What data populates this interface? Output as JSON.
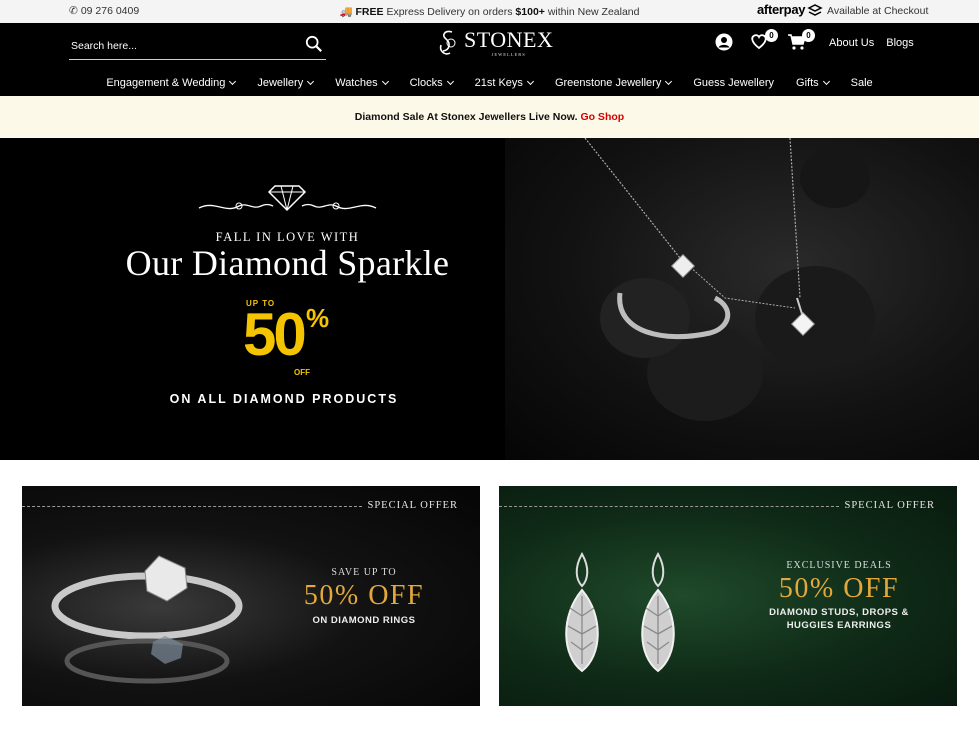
{
  "topbar": {
    "phone": "09 276 0409",
    "promo_bold": "FREE",
    "promo_text": "Express Delivery on orders",
    "promo_amount": "$100+",
    "promo_tail": "within New Zealand",
    "afterpay_logo": "afterpay",
    "afterpay_text": "Available at Checkout"
  },
  "header": {
    "search_placeholder": "Search here...",
    "logo_word": "STONEX",
    "logo_sub": "JEWELLERS",
    "wishlist_count": "0",
    "cart_count": "0",
    "links": [
      "About Us",
      "Blogs"
    ]
  },
  "nav": [
    {
      "label": "Engagement & Wedding",
      "dropdown": true
    },
    {
      "label": "Jewellery",
      "dropdown": true
    },
    {
      "label": "Watches",
      "dropdown": true
    },
    {
      "label": "Clocks",
      "dropdown": true
    },
    {
      "label": "21st Keys",
      "dropdown": true
    },
    {
      "label": "Greenstone Jewellery",
      "dropdown": true
    },
    {
      "label": "Guess Jewellery",
      "dropdown": false
    },
    {
      "label": "Gifts",
      "dropdown": true
    },
    {
      "label": "Sale",
      "dropdown": false
    }
  ],
  "announce": {
    "text": "Diamond Sale At Stonex Jewellers Live Now.",
    "link": "Go Shop"
  },
  "hero": {
    "pre": "FALL IN LOVE WITH",
    "title": "Our Diamond Sparkle",
    "upto": "UP TO",
    "number": "50",
    "percent": "%",
    "off": "OFF",
    "subtitle": "ON ALL DIAMOND PRODUCTS"
  },
  "offers": [
    {
      "tag": "SPECIAL OFFER",
      "top": "SAVE UP TO",
      "big": "50% OFF",
      "bottom": "ON DIAMOND RINGS"
    },
    {
      "tag": "SPECIAL OFFER",
      "top": "EXCLUSIVE DEALS",
      "big": "50% OFF",
      "bottom": "DIAMOND STUDS, DROPS &",
      "bottom2": "HUGGIES EARRINGS"
    }
  ],
  "colors": {
    "accent_gold": "#f5c400",
    "link_red": "#d40000",
    "banner_bg": "#fdf9e8",
    "offer_gold": "#e3a83b"
  }
}
